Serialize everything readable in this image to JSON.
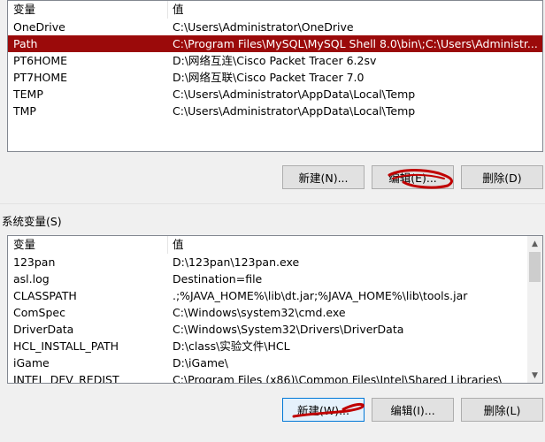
{
  "user_vars": {
    "header": {
      "name": "变量",
      "value": "值"
    },
    "rows": [
      {
        "name": "OneDrive",
        "value": "C:\\Users\\Administrator\\OneDrive",
        "selected": false
      },
      {
        "name": "Path",
        "value": "C:\\Program Files\\MySQL\\MySQL Shell 8.0\\bin\\;C:\\Users\\Administr...",
        "selected": true
      },
      {
        "name": "PT6HOME",
        "value": "D:\\网络互连\\Cisco Packet Tracer 6.2sv",
        "selected": false
      },
      {
        "name": "PT7HOME",
        "value": "D:\\网络互联\\Cisco Packet Tracer 7.0",
        "selected": false
      },
      {
        "name": "TEMP",
        "value": "C:\\Users\\Administrator\\AppData\\Local\\Temp",
        "selected": false
      },
      {
        "name": "TMP",
        "value": "C:\\Users\\Administrator\\AppData\\Local\\Temp",
        "selected": false
      }
    ],
    "buttons": {
      "new": "新建(N)...",
      "edit": "编辑(E)...",
      "delete": "删除(D)"
    }
  },
  "system_vars": {
    "label": "系统变量(S)",
    "header": {
      "name": "变量",
      "value": "值"
    },
    "rows": [
      {
        "name": "123pan",
        "value": "D:\\123pan\\123pan.exe"
      },
      {
        "name": "asl.log",
        "value": "Destination=file"
      },
      {
        "name": "CLASSPATH",
        "value": ".;%JAVA_HOME%\\lib\\dt.jar;%JAVA_HOME%\\lib\\tools.jar"
      },
      {
        "name": "ComSpec",
        "value": "C:\\Windows\\system32\\cmd.exe"
      },
      {
        "name": "DriverData",
        "value": "C:\\Windows\\System32\\Drivers\\DriverData"
      },
      {
        "name": "HCL_INSTALL_PATH",
        "value": "D:\\class\\实验文件\\HCL"
      },
      {
        "name": "iGame",
        "value": "D:\\iGame\\"
      },
      {
        "name": "INTEL_DEV_REDIST",
        "value": "C:\\Program Files (x86)\\Common Files\\Intel\\Shared Libraries\\"
      }
    ],
    "buttons": {
      "new": "新建(W)...",
      "edit": "编辑(I)...",
      "delete": "删除(L)"
    }
  },
  "icons": {
    "scroll_up": "▲",
    "scroll_down": "▼"
  },
  "colors": {
    "selection": "#9b0a0a",
    "annotation": "#c00000"
  }
}
